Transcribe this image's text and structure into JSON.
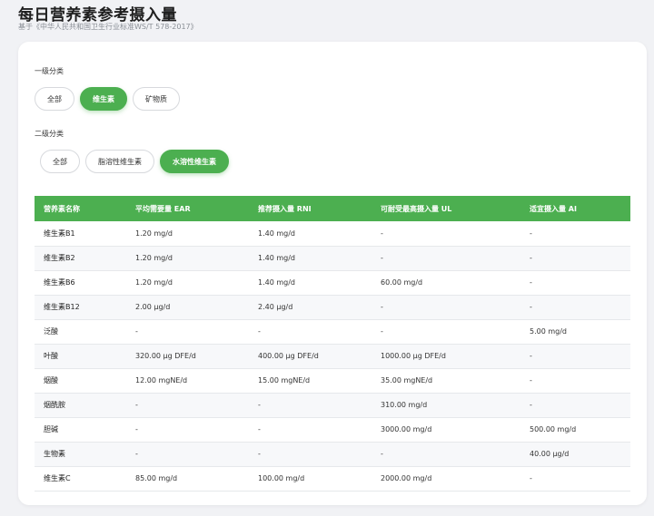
{
  "header": {
    "title": "每日营养素参考摄入量",
    "subtitle": "基于《中华人民共和国卫生行业标准WS/T 578-2017》"
  },
  "filters": {
    "level1_label": "一级分类",
    "level1_options": [
      "全部",
      "维生素",
      "矿物质"
    ],
    "level1_selected": "维生素",
    "level2_label": "二级分类",
    "level2_options": [
      "全部",
      "脂溶性维生素",
      "水溶性维生素"
    ],
    "level2_selected": "水溶性维生素"
  },
  "table": {
    "headers": [
      "营养素名称",
      "平均需要量 EAR",
      "推荐摄入量 RNI",
      "可耐受最高摄入量 UL",
      "适宜摄入量 AI"
    ],
    "rows": [
      [
        "维生素B1",
        "1.20 mg/d",
        "1.40 mg/d",
        "-",
        "-"
      ],
      [
        "维生素B2",
        "1.20 mg/d",
        "1.40 mg/d",
        "-",
        "-"
      ],
      [
        "维生素B6",
        "1.20 mg/d",
        "1.40 mg/d",
        "60.00 mg/d",
        "-"
      ],
      [
        "维生素B12",
        "2.00 μg/d",
        "2.40 μg/d",
        "-",
        "-"
      ],
      [
        "泛酸",
        "-",
        "-",
        "-",
        "5.00 mg/d"
      ],
      [
        "叶酸",
        "320.00 μg DFE/d",
        "400.00 μg DFE/d",
        "1000.00 μg DFE/d",
        "-"
      ],
      [
        "烟酸",
        "12.00 mgNE/d",
        "15.00 mgNE/d",
        "35.00 mgNE/d",
        "-"
      ],
      [
        "烟酰胺",
        "-",
        "-",
        "310.00 mg/d",
        "-"
      ],
      [
        "胆碱",
        "-",
        "-",
        "3000.00 mg/d",
        "500.00 mg/d"
      ],
      [
        "生物素",
        "-",
        "-",
        "-",
        "40.00 μg/d"
      ],
      [
        "维生素C",
        "85.00 mg/d",
        "100.00 mg/d",
        "2000.00 mg/d",
        "-"
      ]
    ]
  },
  "colors": {
    "accent": "#4caf50",
    "page_background": "#f1f2f5",
    "card_background": "#ffffff"
  }
}
